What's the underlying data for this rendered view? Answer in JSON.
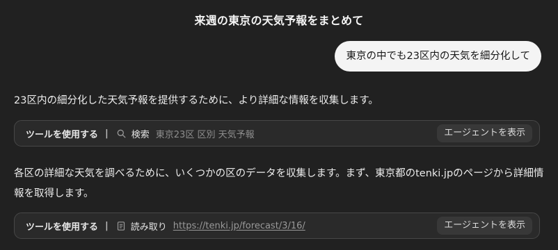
{
  "page_title": "来週の東京の天気予報をまとめて",
  "user_message": "東京の中でも23区内の天気を細分化して",
  "assistant": {
    "paragraph_1": "23区内の細分化した天気予報を提供するために、より詳細な情報を収集します。",
    "tool_call_1": {
      "label": "ツールを使用する",
      "separator": "|",
      "icon": "search-icon",
      "action": "検索",
      "query": "東京23区 区別 天気予報",
      "button": "エージェントを表示"
    },
    "paragraph_2": "各区の詳細な天気を調べるために、いくつかの区のデータを収集します。まず、東京都のtenki.jpのページから詳細情報を取得します。",
    "tool_call_2": {
      "label": "ツールを使用する",
      "separator": "|",
      "icon": "document-icon",
      "action": "読み取り",
      "link": "https://tenki.jp/forecast/3/16/",
      "button": "エージェントを表示"
    }
  },
  "colors": {
    "background": "#212121",
    "user_bubble": "#f4f4f4",
    "tool_bar_bg": "#2a2a2a",
    "tool_bar_border": "#474747",
    "button_bg": "#383838"
  }
}
